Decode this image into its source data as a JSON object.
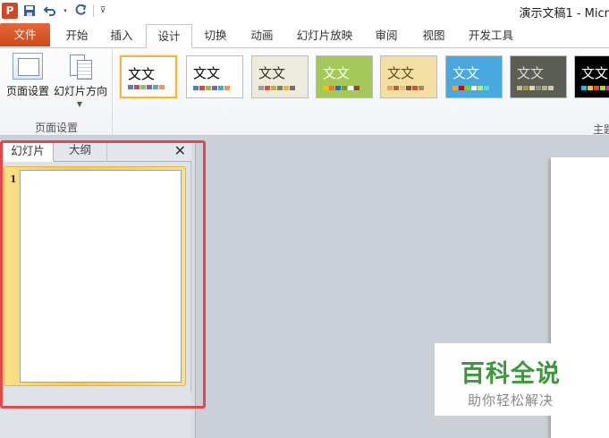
{
  "app": {
    "icon_letter": "P",
    "window_title": "演示文稿1 - Micr"
  },
  "quick_access": {
    "save_icon": "save-icon",
    "undo_icon": "undo-icon",
    "redo_icon": "redo-icon",
    "customize_icon": "customize-icon"
  },
  "ribbon_tabs": [
    {
      "label": "文件"
    },
    {
      "label": "开始"
    },
    {
      "label": "插入"
    },
    {
      "label": "设计"
    },
    {
      "label": "切换"
    },
    {
      "label": "动画"
    },
    {
      "label": "幻灯片放映"
    },
    {
      "label": "审阅"
    },
    {
      "label": "视图"
    },
    {
      "label": "开发工具"
    }
  ],
  "active_tab": "设计",
  "page_setup_group": {
    "page_setup_label": "页面设置",
    "orientation_label": "幻灯片方向",
    "group_label": "页面设置"
  },
  "themes_group": {
    "group_label": "主题",
    "themes": [
      {
        "text": "文文",
        "bg": "#ffffff",
        "fg": "#000000",
        "selected": true
      },
      {
        "text": "文文",
        "bg": "#ffffff",
        "fg": "#000000",
        "selected": false
      },
      {
        "text": "文文",
        "bg": "#ecebdc",
        "fg": "#333333",
        "selected": false
      },
      {
        "text": "文文",
        "bg": "#a4c85a",
        "fg": "#ffffff",
        "selected": false
      },
      {
        "text": "文文",
        "bg": "#f3dfa4",
        "fg": "#6a4a1a",
        "selected": false
      },
      {
        "text": "文文",
        "bg": "#4aa8e0",
        "fg": "#ffffff",
        "selected": false
      },
      {
        "text": "文文",
        "bg": "#5b5e55",
        "fg": "#dadada",
        "selected": false
      },
      {
        "text": "文文",
        "bg": "#000000",
        "fg": "#ffffff",
        "selected": false
      }
    ]
  },
  "slides_pane": {
    "tab_slides": "幻灯片",
    "tab_outline": "大纲",
    "close_symbol": "✕",
    "slide_number": "1"
  },
  "watermark": {
    "title": "百科全说",
    "subtitle": "助你轻松解决"
  },
  "highlight_color": "#e04a4a"
}
